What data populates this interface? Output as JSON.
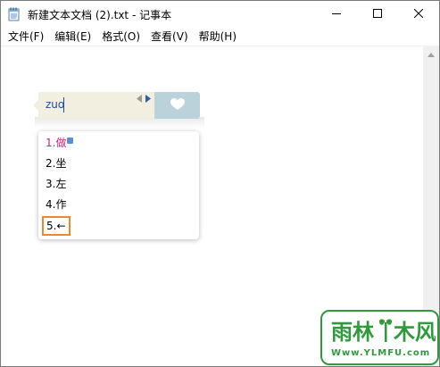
{
  "window": {
    "title": "新建文本文档 (2).txt - 记事本"
  },
  "menu": {
    "items": [
      {
        "label": "文件(F)"
      },
      {
        "label": "编辑(E)"
      },
      {
        "label": "格式(O)"
      },
      {
        "label": "查看(V)"
      },
      {
        "label": "帮助(H)"
      }
    ]
  },
  "ime": {
    "pinyin": "zuo",
    "candidates": [
      {
        "label": "1.做"
      },
      {
        "label": "2.坐"
      },
      {
        "label": "3.左"
      },
      {
        "label": "4.作"
      },
      {
        "label": "5.←",
        "highlighted": true
      }
    ],
    "highlight_color": "#e8892f",
    "first_candidate_color": "#c8277c"
  },
  "watermark": {
    "logo_text": "雨林木风",
    "url": "Www.YLMFU.com",
    "color": "#2f9a3c"
  },
  "icons": {
    "app": "notepad-icon",
    "minimize": "minimize-icon",
    "maximize": "maximize-icon",
    "close": "close-icon",
    "ime_prev": "triangle-left-icon",
    "ime_next": "triangle-right-icon",
    "ime_skin": "heart-icon"
  }
}
